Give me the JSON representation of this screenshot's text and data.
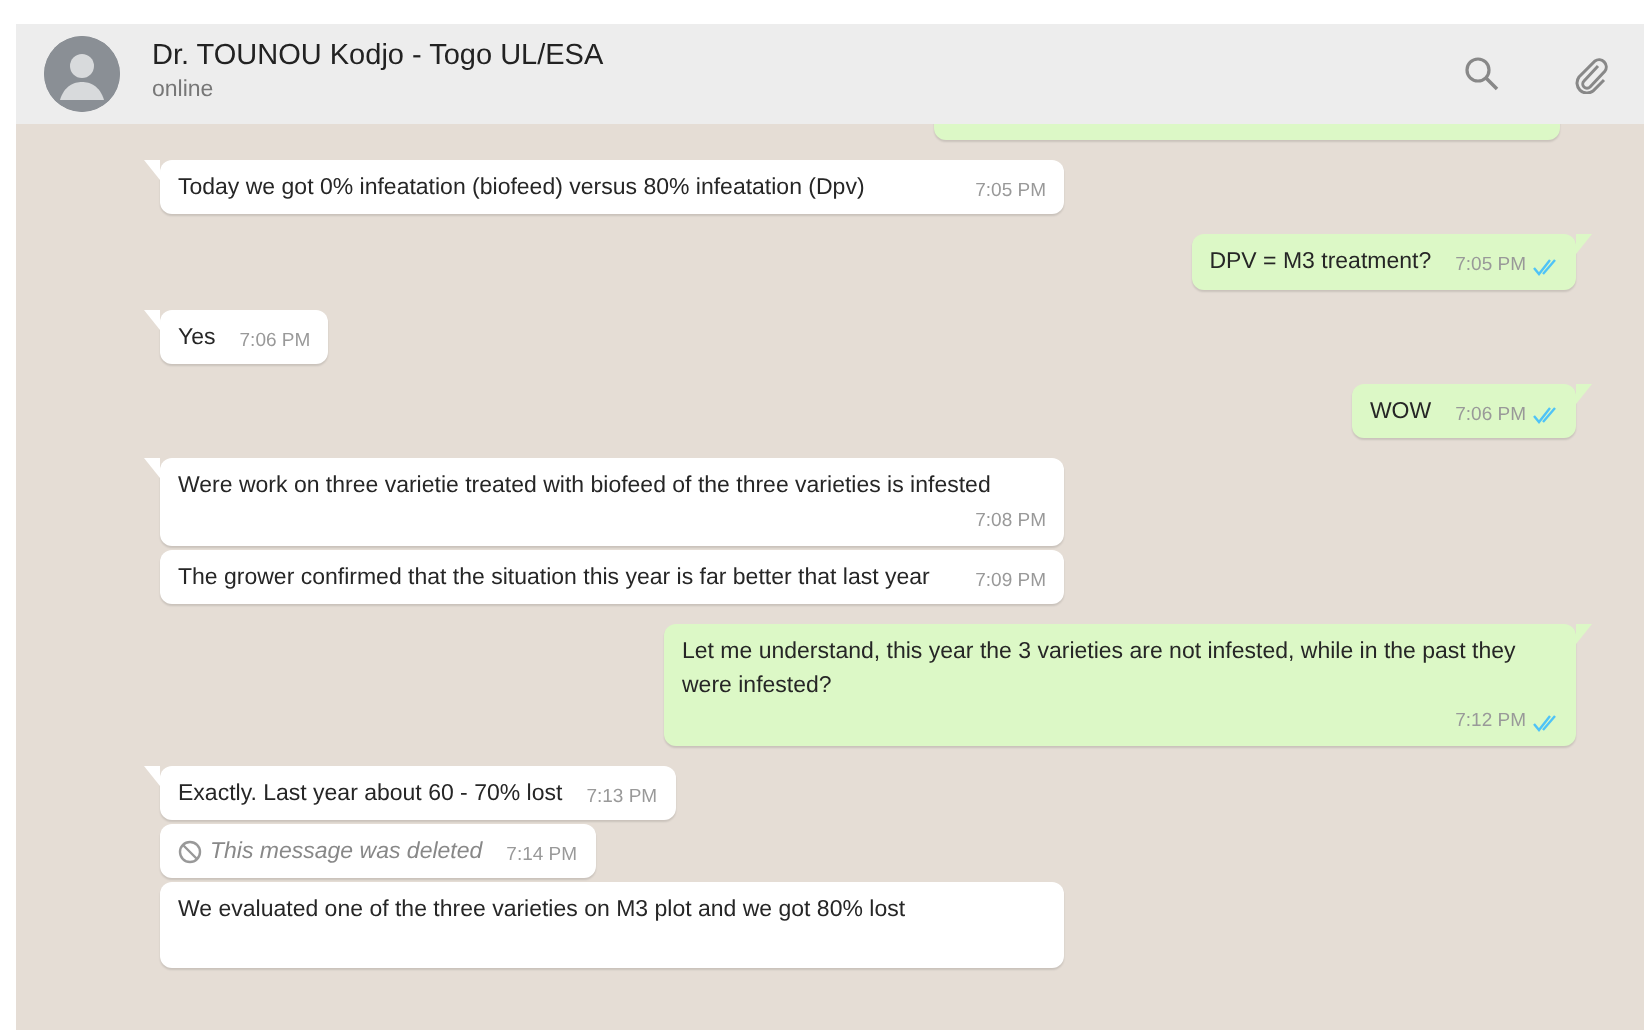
{
  "header": {
    "name": "Dr. TOUNOU Kodjo - Togo UL/ESA",
    "status": "online"
  },
  "messages": [
    {
      "kind": "outgoing",
      "clipped": true
    },
    {
      "kind": "incoming",
      "tail": true,
      "text": "Today we got 0% infeatation (biofeed) versus 80% infeatation (Dpv)",
      "time": "7:05 PM",
      "wide": true
    },
    {
      "kind": "outgoing",
      "tail": true,
      "text": "DPV = M3 treatment?",
      "time": "7:05 PM",
      "read": true
    },
    {
      "kind": "incoming",
      "tail": true,
      "text": "Yes",
      "time": "7:06 PM"
    },
    {
      "kind": "outgoing",
      "tail": true,
      "text": "WOW",
      "time": "7:06 PM",
      "read": true
    },
    {
      "kind": "incoming",
      "tail": true,
      "text": "Were work on three varietie treated with biofeed of the three varieties is infested",
      "time": "7:08 PM",
      "wide": true
    },
    {
      "kind": "incoming",
      "tail": false,
      "text": "The grower confirmed that the situation this year is far better that last year",
      "time": "7:09 PM",
      "wide": true
    },
    {
      "kind": "outgoing",
      "tail": true,
      "text": "Let me understand, this year the 3 varieties are not infested, while in the past they were infested?",
      "time": "7:12 PM",
      "read": true,
      "wide": true
    },
    {
      "kind": "incoming",
      "tail": true,
      "text": "Exactly. Last year about 60 - 70% lost",
      "time": "7:13 PM"
    },
    {
      "kind": "deleted",
      "tail": false,
      "text": "This message was deleted",
      "time": "7:14 PM"
    },
    {
      "kind": "incoming",
      "tail": false,
      "text": "We evaluated one of the three varieties on M3 plot and we got 80% lost",
      "wide": true
    }
  ]
}
